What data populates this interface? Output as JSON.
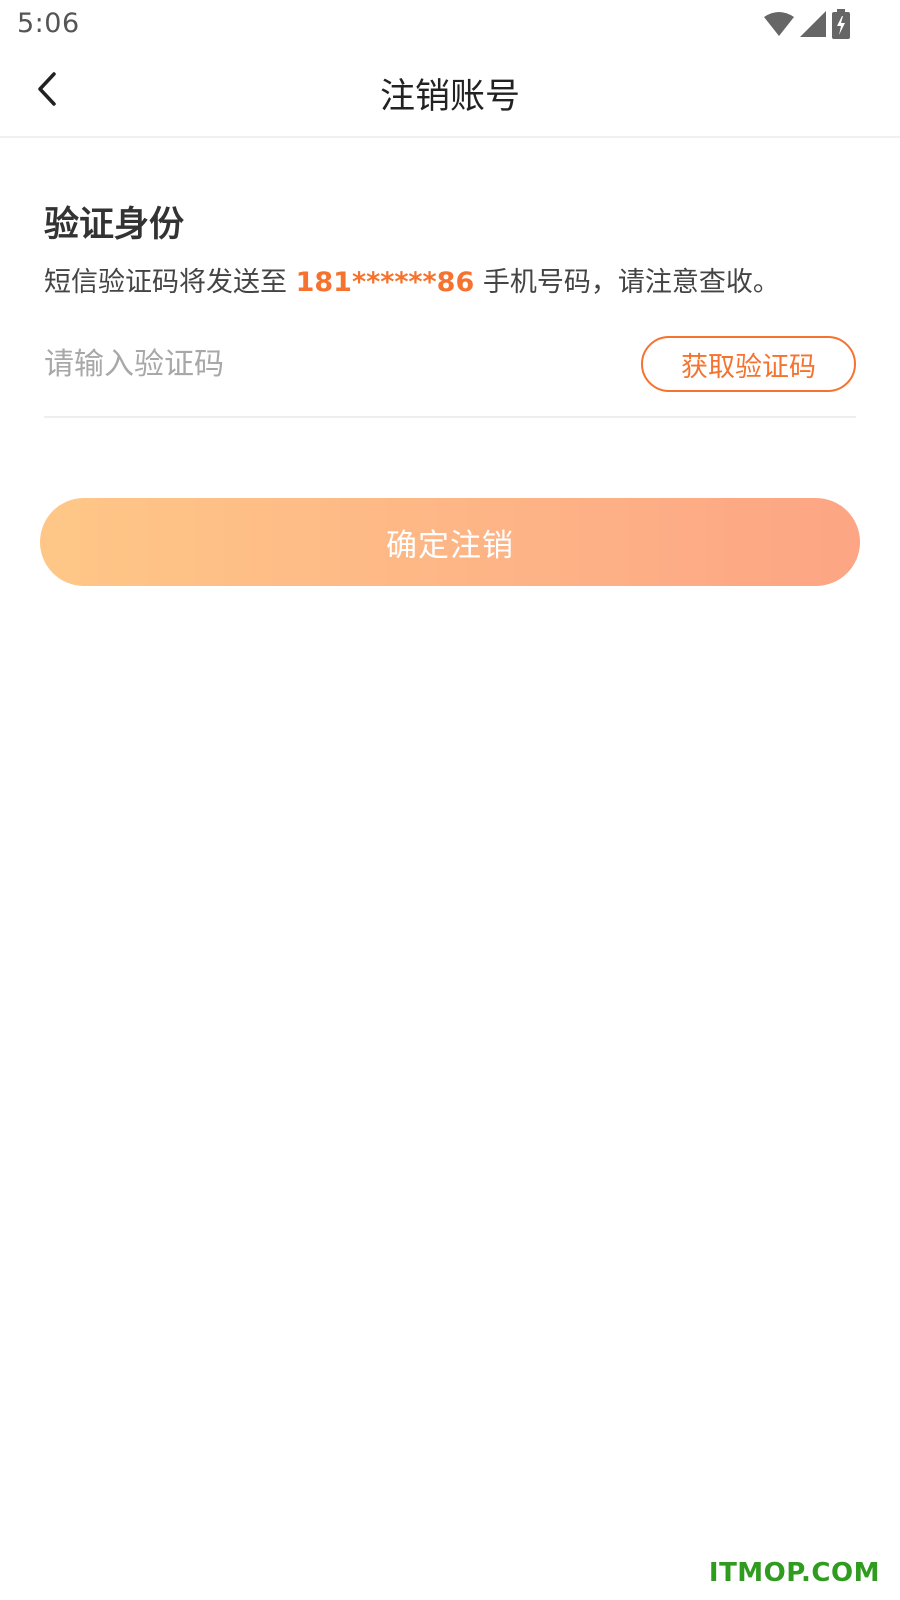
{
  "status_bar": {
    "time": "5:06",
    "icons": [
      "wifi-icon",
      "signal-icon",
      "battery-charging-icon"
    ]
  },
  "nav": {
    "back_icon": "chevron-left-icon",
    "title": "注销账号"
  },
  "verify": {
    "title": "验证身份",
    "info_prefix": "短信验证码将发送至",
    "phone": "181******86",
    "info_suffix": "手机号码，请注意查收。"
  },
  "code_input": {
    "placeholder": "请输入验证码",
    "value": ""
  },
  "get_code_button": {
    "label": "获取验证码"
  },
  "confirm_button": {
    "label": "确定注销"
  },
  "watermark": {
    "text": "ITMOP.COM"
  },
  "colors": {
    "accent": "#f5732e",
    "gradient_start": "#fec787",
    "gradient_end": "#fda584",
    "watermark": "#2f9b1f"
  }
}
